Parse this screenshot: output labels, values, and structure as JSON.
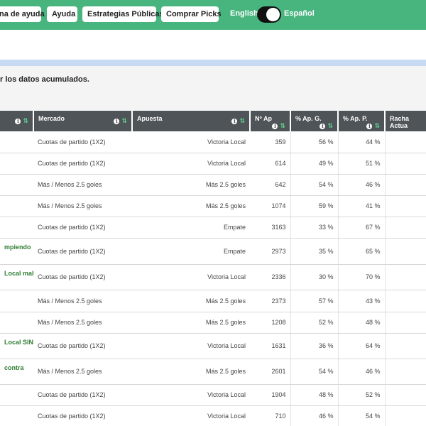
{
  "nav": {
    "buttons": [
      "na de ayuda",
      "Ayuda",
      "Estrategias Públicas",
      "Comprar Picks"
    ],
    "lang_english": "English",
    "lang_spanish": "Español"
  },
  "intro_text": "r los datos acumulados.",
  "colors": {
    "topbar": "#48b57f",
    "header": "#4f5458",
    "accent_name": "#2e7d32"
  },
  "table": {
    "headers": {
      "mercado": "Mercado",
      "apuesta": "Apuesta",
      "n_ap": "Nº Ap",
      "pct_g": "% Ap. G.",
      "pct_p": "% Ap. P.",
      "racha": "Racha Actua"
    },
    "rows": [
      {
        "name": "",
        "mercado": "Cuotas de partido (1X2)",
        "apuesta": "Victoria Local",
        "n": "359",
        "g": "56 %",
        "p": "44 %"
      },
      {
        "name": "",
        "mercado": "Cuotas de partido (1X2)",
        "apuesta": "Victoria Local",
        "n": "614",
        "g": "49 %",
        "p": "51 %"
      },
      {
        "name": "",
        "mercado": "Más / Menos 2.5 goles",
        "apuesta": "Más 2.5 goles",
        "n": "642",
        "g": "54 %",
        "p": "46 %"
      },
      {
        "name": "",
        "mercado": "Más / Menos 2.5 goles",
        "apuesta": "Más 2.5 goles",
        "n": "1074",
        "g": "59 %",
        "p": "41 %"
      },
      {
        "name": "",
        "mercado": "Cuotas de partido (1X2)",
        "apuesta": "Empate",
        "n": "3163",
        "g": "33 %",
        "p": "67 %"
      },
      {
        "name": "mpiendo",
        "mercado": "Cuotas de partido (1X2)",
        "apuesta": "Empate",
        "n": "2973",
        "g": "35 %",
        "p": "65 %"
      },
      {
        "name": "Local mala",
        "mercado": "Cuotas de partido (1X2)",
        "apuesta": "Victoria Local",
        "n": "2336",
        "g": "30 %",
        "p": "70 %"
      },
      {
        "name": "",
        "mercado": "Más / Menos 2.5 goles",
        "apuesta": "Más 2.5 goles",
        "n": "2373",
        "g": "57 %",
        "p": "43 %"
      },
      {
        "name": "",
        "mercado": "Más / Menos 2.5 goles",
        "apuesta": "Más 2.5 goles",
        "n": "1208",
        "g": "52 %",
        "p": "48 %"
      },
      {
        "name": "Local SIN",
        "mercado": "Cuotas de partido (1X2)",
        "apuesta": "Victoria Local",
        "n": "1631",
        "g": "36 %",
        "p": "64 %"
      },
      {
        "name": "contra",
        "mercado": "Más / Menos 2.5 goles",
        "apuesta": "Más 2.5 goles",
        "n": "2601",
        "g": "54 %",
        "p": "46 %"
      },
      {
        "name": "",
        "mercado": "Cuotas de partido (1X2)",
        "apuesta": "Victoria Local",
        "n": "1904",
        "g": "48 %",
        "p": "52 %"
      },
      {
        "name": "",
        "mercado": "Cuotas de partido (1X2)",
        "apuesta": "Victoria Local",
        "n": "710",
        "g": "46 %",
        "p": "54 %"
      }
    ]
  }
}
